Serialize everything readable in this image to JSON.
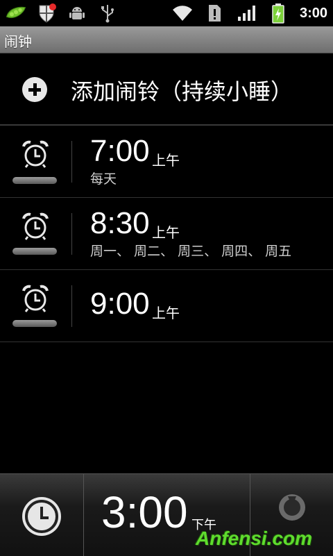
{
  "status_bar": {
    "time": "3:00",
    "icons": [
      "pea-pod-icon",
      "shield-icon",
      "android-debug-icon",
      "usb-icon",
      "wifi-icon",
      "sim-alert-icon",
      "signal-icon",
      "battery-charging-icon"
    ]
  },
  "title_bar": {
    "title": "闹钟"
  },
  "add_alarm": {
    "label": "添加闹铃（持续小睡）",
    "icon": "plus-circle-icon"
  },
  "alarms": [
    {
      "time": "7:00",
      "ampm": "上午",
      "days": "每天",
      "enabled": false
    },
    {
      "time": "8:30",
      "ampm": "上午",
      "days": "周一、 周二、 周三、 周四、 周五",
      "enabled": false
    },
    {
      "time": "9:00",
      "ampm": "上午",
      "days": "",
      "enabled": false
    }
  ],
  "bottom_bar": {
    "time": "3:00",
    "ampm": "下午",
    "left_icon": "clock-icon",
    "right_icon": "settings-icon"
  },
  "watermark": "Anfensi.com",
  "colors": {
    "watermark": "#5fdc2e",
    "accent_green": "#7cd13a",
    "notification_red": "#e62a2a"
  }
}
